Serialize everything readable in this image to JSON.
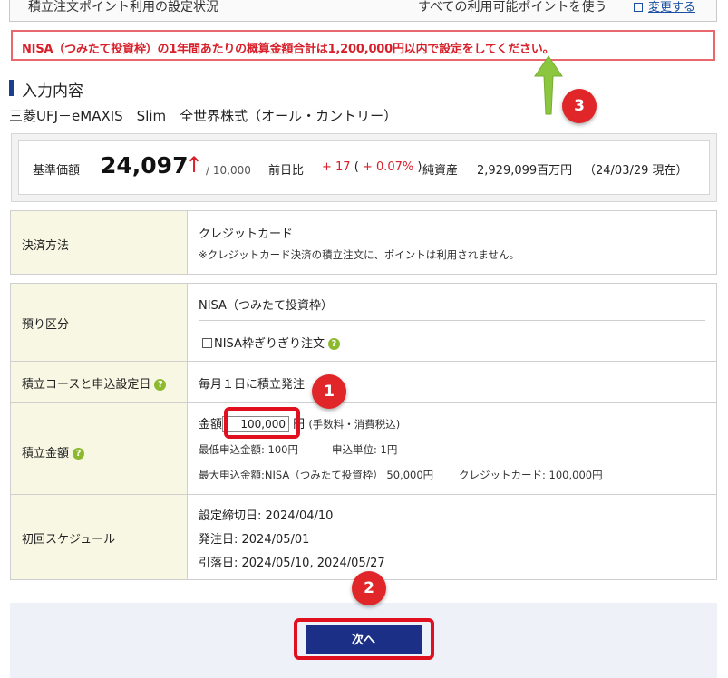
{
  "top_row": {
    "left_text": "積立注文ポイント利用の設定状況",
    "middle_text": "すべての利用可能ポイントを使う",
    "change_link": "変更する"
  },
  "error_message": "NISA（つみたて投資枠）の1年間あたりの概算金額合計は1,200,000円以内で設定をしてください。",
  "section_title": "入力内容",
  "fund_name": "三菱UFJ－eMAXIS　Slim　全世界株式（オール・カントリー）",
  "price": {
    "label": "基準価額",
    "value": "24,097",
    "arrow": "↑",
    "unit": "/ 10,000",
    "prev_label": "前日比",
    "change_abs": "+ 17",
    "change_pct": "+ 0.07%",
    "net_assets_label": "純資産",
    "net_assets_value": "2,929,099百万円",
    "as_of": "（24/03/29 現在）"
  },
  "payment": {
    "label": "決済方法",
    "method": "クレジットカード",
    "note": "※クレジットカード決済の積立注文に、ポイントは利用されません。"
  },
  "account": {
    "label": "預り区分",
    "value": "NISA（つみたて投資枠）",
    "checkbox_label": "NISA枠ぎりぎり注文"
  },
  "course": {
    "label": "積立コースと申込設定日",
    "value": "毎月１日に積立発注"
  },
  "amount": {
    "label": "積立金額",
    "prefix": "金額",
    "value": "100,000",
    "suffix": "円",
    "suffix_note": "(手数料・消費税込)",
    "min_label": "最低申込金額: 100円",
    "unit_label": "申込単位: 1円",
    "max_label": "最大申込金額:NISA（つみたて投資枠） 50,000円",
    "credit_label": "クレジットカード: 100,000円"
  },
  "schedule": {
    "label": "初回スケジュール",
    "deadline": "設定締切日: 2024/04/10",
    "order_date": "発注日: 2024/05/01",
    "debit_date": "引落日: 2024/05/10, 2024/05/27"
  },
  "next_button": "次へ",
  "help_glyph": "?",
  "annotations": {
    "badge1": "1",
    "badge2": "2",
    "badge3": "3"
  },
  "colors": {
    "error_red": "#d8202a",
    "navy": "#1b2f87",
    "label_bg": "#f7f7e4",
    "help_green": "#8db92e",
    "annotation_red": "#e0101e",
    "arrow_green": "#8cc63f"
  }
}
